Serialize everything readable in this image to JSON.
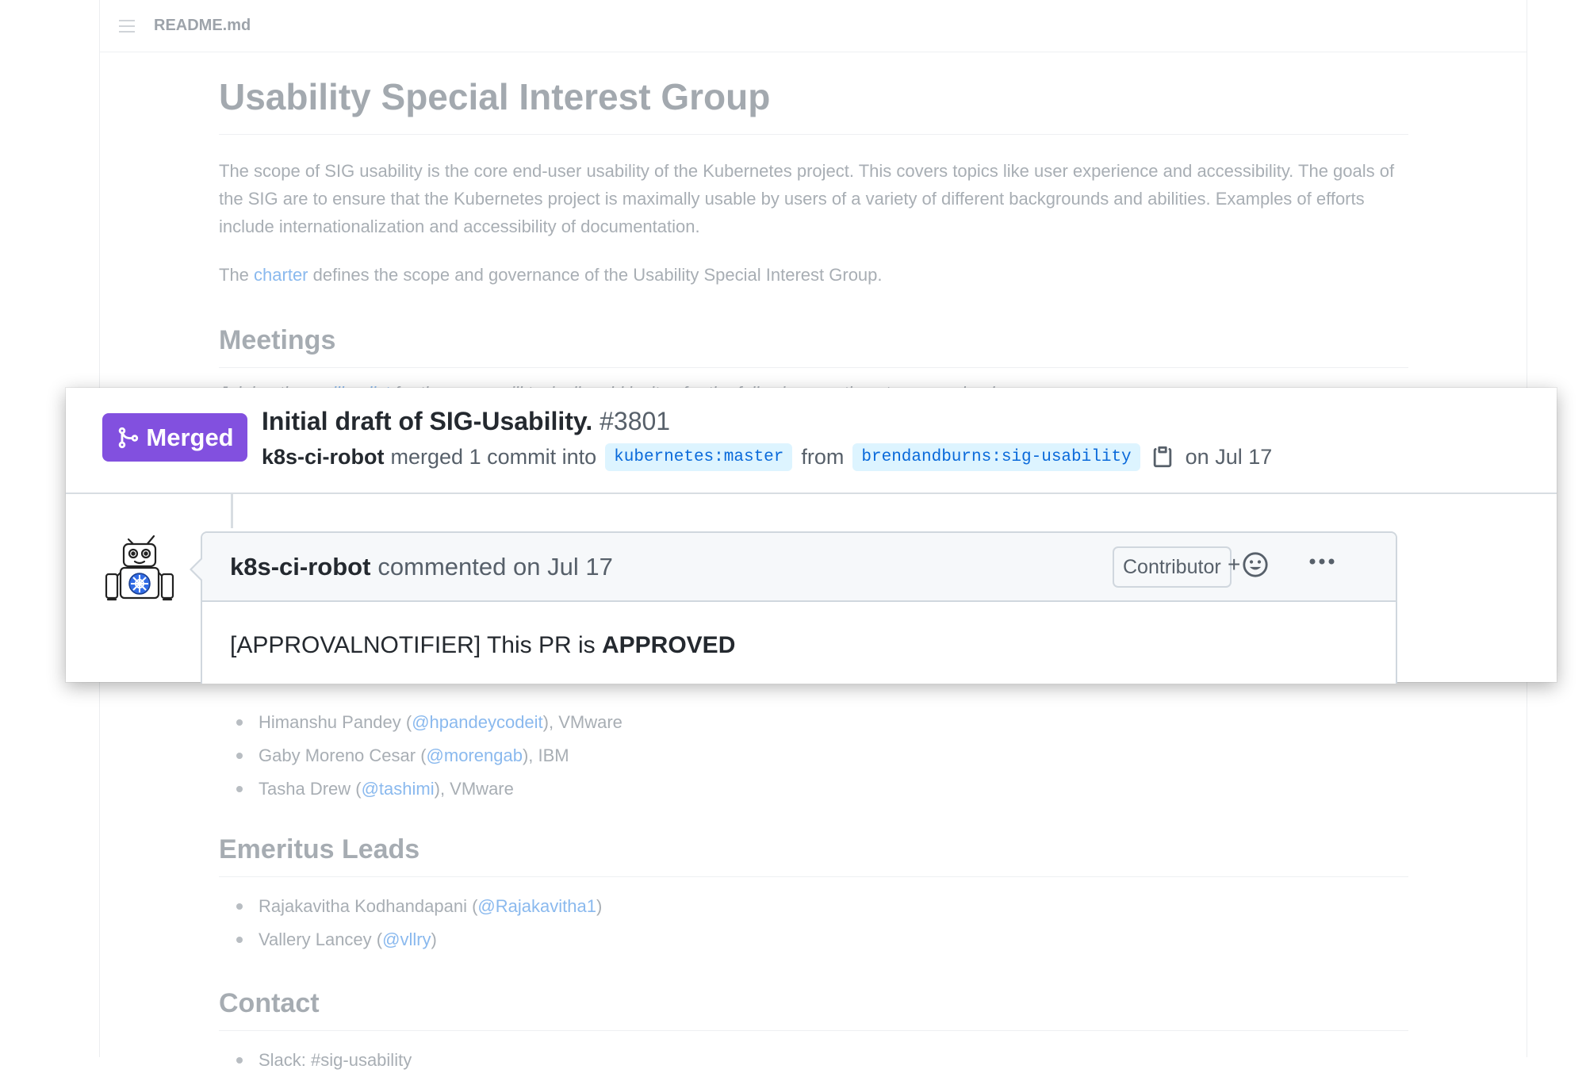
{
  "readme": {
    "filename": "README.md",
    "title": "Usability Special Interest Group",
    "intro": "The scope of SIG usability is the core end-user usability of the Kubernetes project. This covers topics like user experience and accessibility. The goals of the SIG are to ensure that the Kubernetes project is maximally usable by users of a variety of different backgrounds and abilities. Examples of efforts include internationalization and accessibility of documentation.",
    "charter_prefix": "The ",
    "charter_link": "charter",
    "charter_suffix": " defines the scope and governance of the Usability Special Interest Group.",
    "meetings_heading": "Meetings",
    "meetings_text_prefix": "Joining the ",
    "meetings_link": "mailing list",
    "meetings_text_suffix": " for the group will typically add invites for the following meetings to your calendar.",
    "leads": [
      {
        "name": "Himanshu Pandey (",
        "handle": "@hpandeycodeit",
        "org": "), VMware"
      },
      {
        "name": "Gaby Moreno Cesar (",
        "handle": "@morengab",
        "org": "), IBM"
      },
      {
        "name": "Tasha Drew (",
        "handle": "@tashimi",
        "org": "), VMware"
      }
    ],
    "emeritus_heading": "Emeritus Leads",
    "emeritus": [
      {
        "name": "Rajakavitha Kodhandapani (",
        "handle": "@Rajakavitha1",
        "org": ")"
      },
      {
        "name": "Vallery Lancey (",
        "handle": "@vllry",
        "org": ")"
      }
    ],
    "contact_heading": "Contact",
    "contact_item": "Slack: #sig-usability"
  },
  "pr": {
    "status": "Merged",
    "title": "Initial draft of SIG-Usability.",
    "number": "#3801",
    "author": "k8s-ci-robot",
    "action": "merged 1 commit into",
    "base_branch": "kubernetes:master",
    "from_label": "from",
    "head_branch": "brendandburns:sig-usability",
    "date": "on Jul 17",
    "accent_color": "#8250df"
  },
  "comment": {
    "author": "k8s-ci-robot",
    "action": "commented on Jul 17",
    "role_badge": "Contributor",
    "reaction_plus": "+",
    "body_prefix": "[APPROVALNOTIFIER] This PR is ",
    "body_bold": "APPROVED"
  }
}
